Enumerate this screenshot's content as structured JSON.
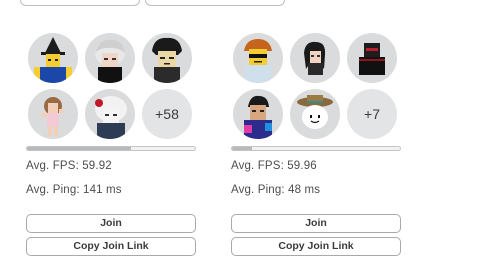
{
  "servers": [
    {
      "more_players": "+58",
      "capacity_fraction": 0.62,
      "fps": "Avg. FPS: 59.92",
      "ping": "Avg. Ping: 141 ms",
      "join_label": "Join",
      "copy_link_label": "Copy Join Link"
    },
    {
      "more_players": "+7",
      "capacity_fraction": 0.12,
      "fps": "Avg. FPS: 59.96",
      "ping": "Avg. Ping: 48 ms",
      "join_label": "Join",
      "copy_link_label": "Copy Join Link"
    }
  ],
  "colors": {
    "avatar_bg": "#dadbdc",
    "button_border": "#a8a9aa",
    "capacity_fill": "#b8b9ba",
    "text": "#393b3d"
  }
}
